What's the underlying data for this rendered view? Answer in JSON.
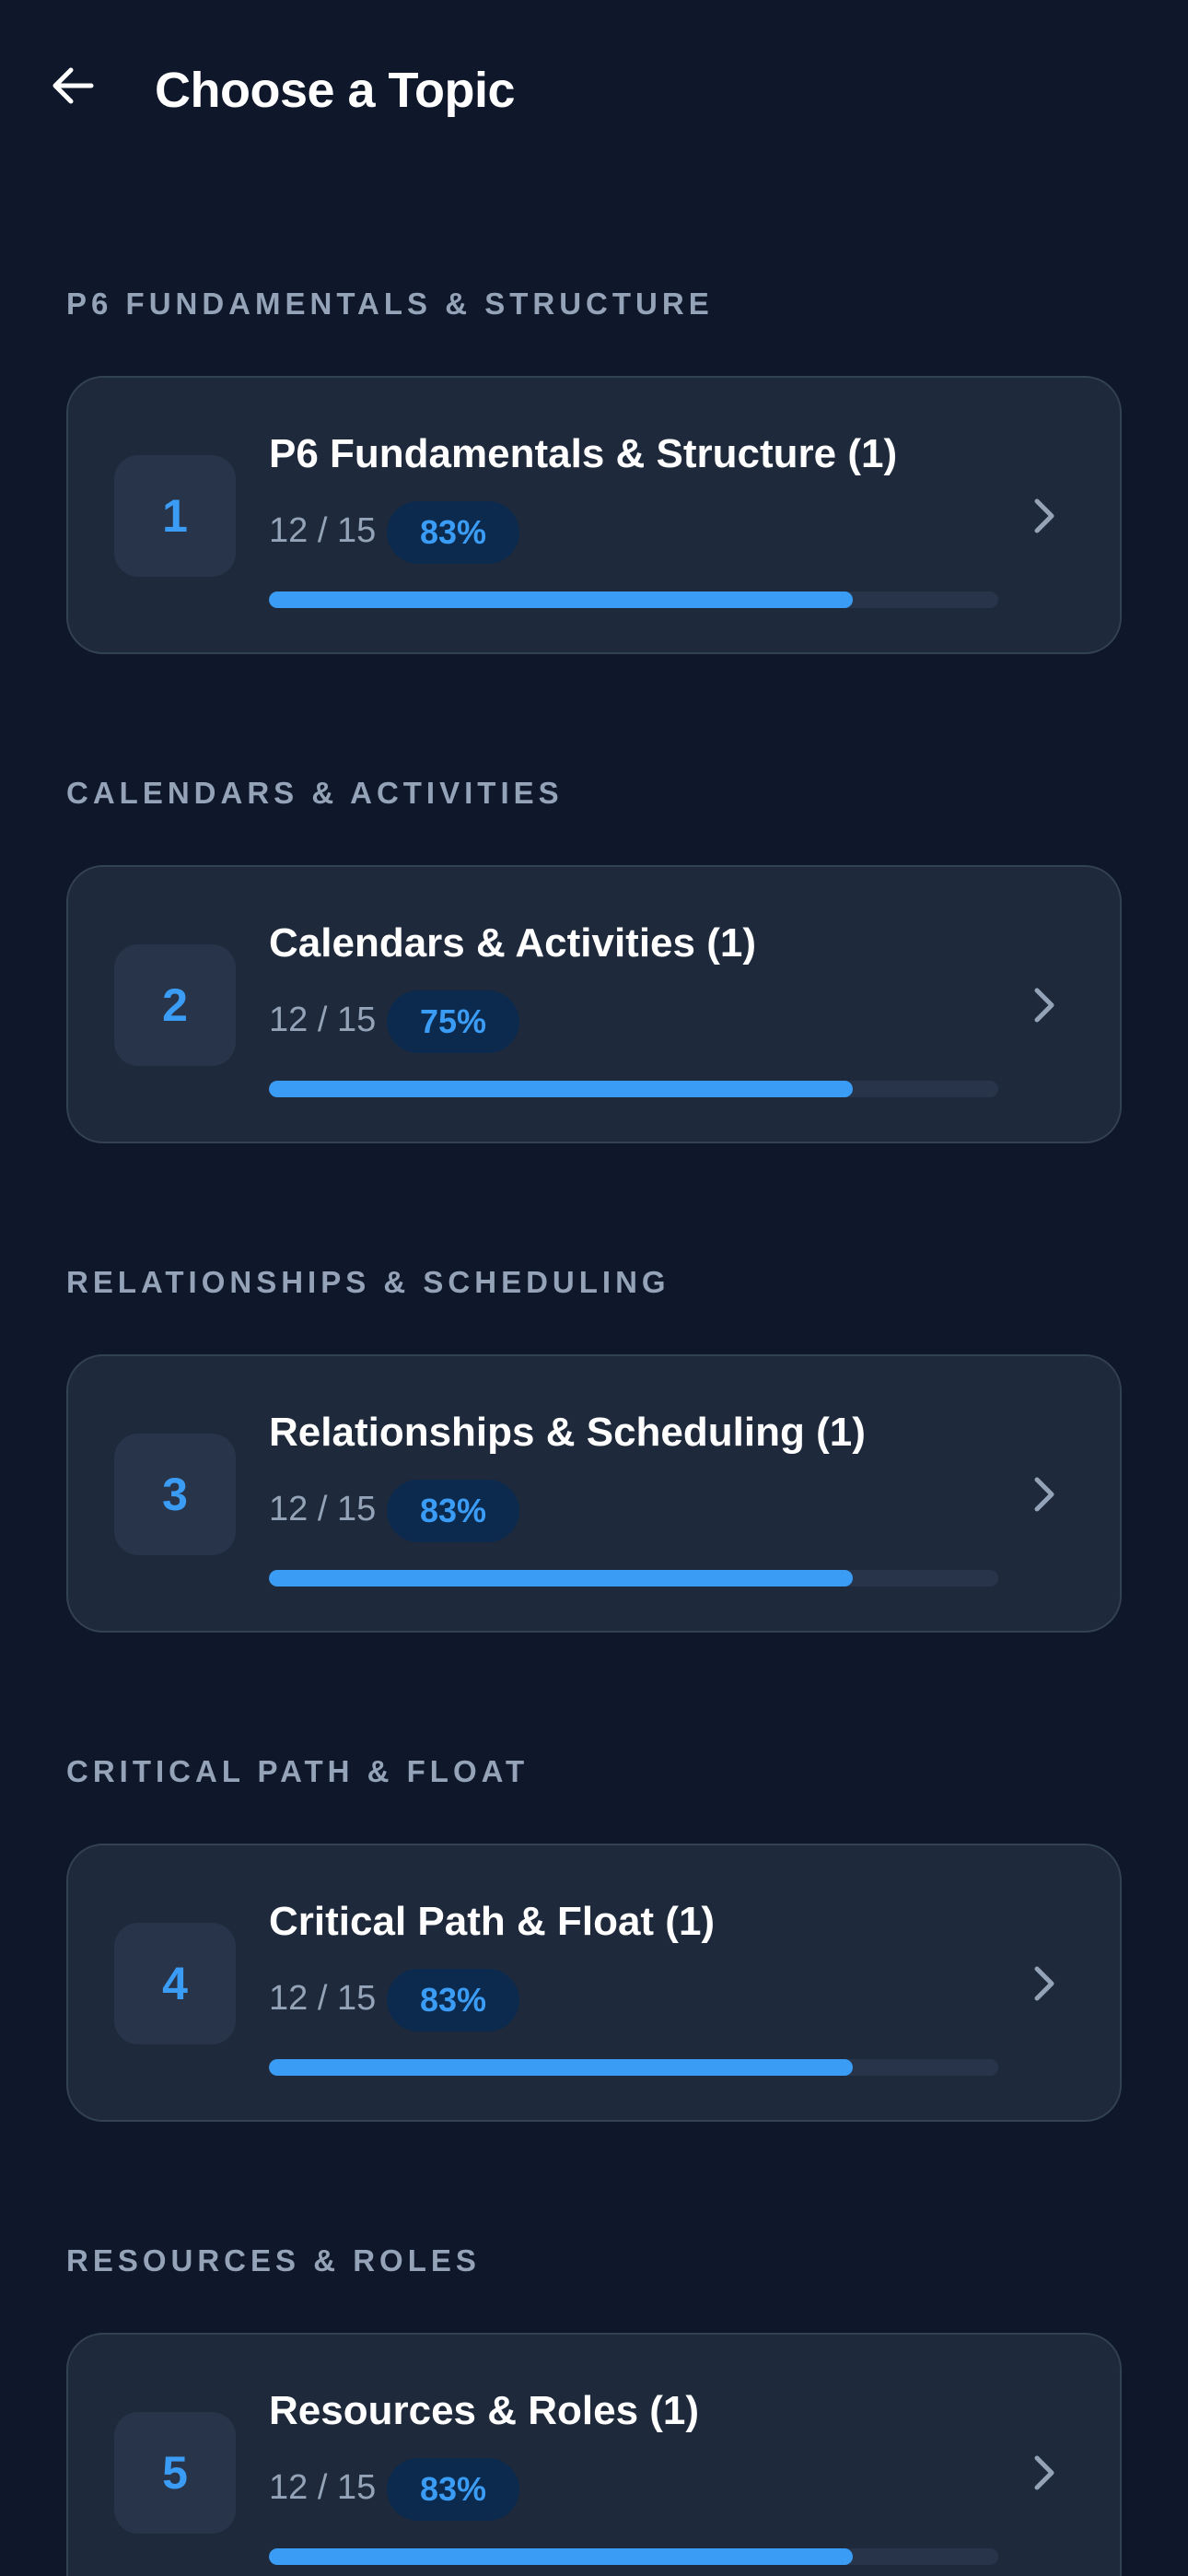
{
  "header": {
    "title": "Choose a Topic",
    "back_icon": "arrow-left-icon"
  },
  "colors": {
    "background": "#0f172a",
    "card": "#1e293b",
    "card_border": "#334155",
    "accent": "#3b9cf6",
    "muted_text": "#94a3b8"
  },
  "topics": [
    {
      "section": "P6 FUNDAMENTALS & STRUCTURE",
      "number": "1",
      "title": "P6 Fundamentals & Structure (1)",
      "count": "12 / 15",
      "percent": "83%",
      "progress": 0.8
    },
    {
      "section": "CALENDARS & ACTIVITIES",
      "number": "2",
      "title": "Calendars & Activities (1)",
      "count": "12 / 15",
      "percent": "75%",
      "progress": 0.8
    },
    {
      "section": "RELATIONSHIPS & SCHEDULING",
      "number": "3",
      "title": "Relationships & Scheduling (1)",
      "count": "12 / 15",
      "percent": "83%",
      "progress": 0.8
    },
    {
      "section": "CRITICAL PATH & FLOAT",
      "number": "4",
      "title": "Critical Path & Float (1)",
      "count": "12 / 15",
      "percent": "83%",
      "progress": 0.8
    },
    {
      "section": "RESOURCES & ROLES",
      "number": "5",
      "title": "Resources & Roles (1)",
      "count": "12 / 15",
      "percent": "83%",
      "progress": 0.8
    }
  ]
}
